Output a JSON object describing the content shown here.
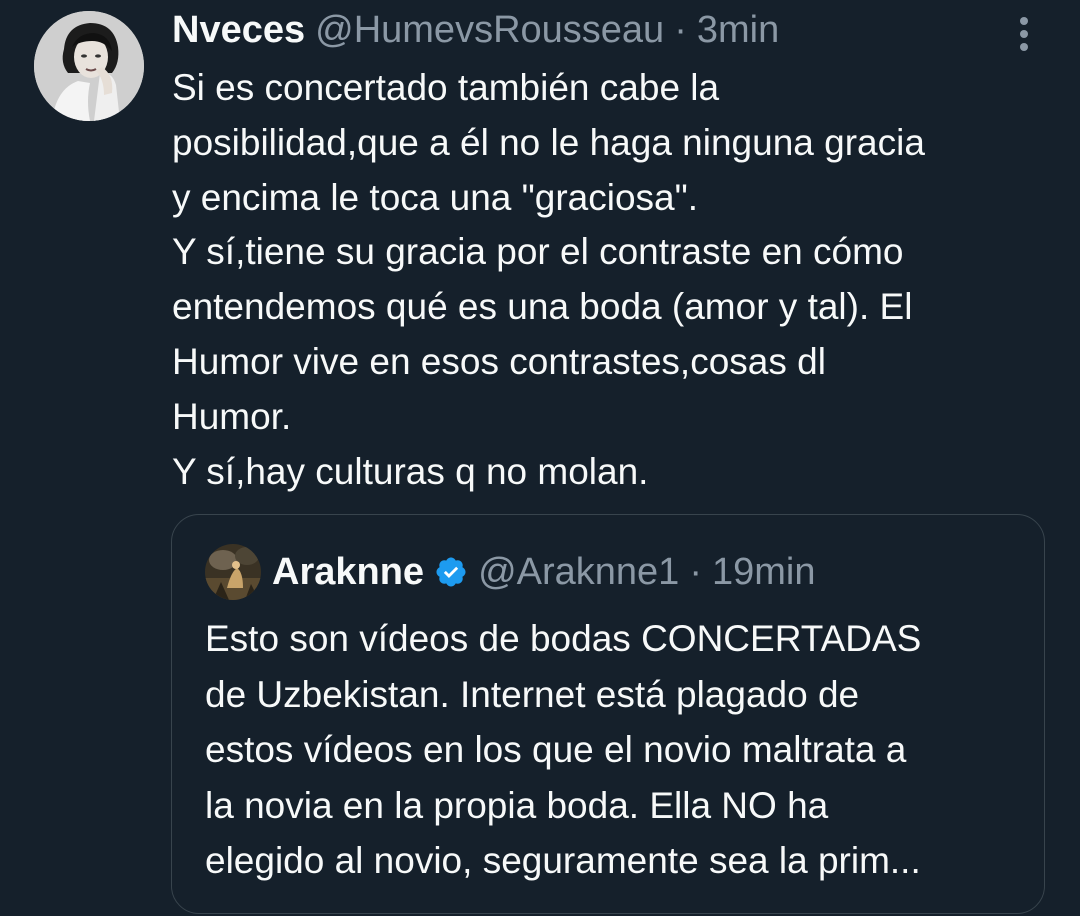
{
  "tweet": {
    "name": "Nveces",
    "handle": "@HumevsRousseau",
    "separator": "·",
    "time": "3min",
    "lines": [
      "Si es concertado también cabe la",
      "posibilidad,que a él no le haga ninguna gracia",
      "y encima le toca una \"graciosa\".",
      "Y sí,tiene su gracia por el contraste en cómo",
      "entendemos qué es una boda (amor y tal). El",
      "Humor vive en esos contrastes,cosas dl",
      "Humor.",
      "Y sí,hay culturas q no molan."
    ]
  },
  "quote": {
    "name": "Araknne",
    "handle": "@Araknne1",
    "separator": "·",
    "time": "19min",
    "verified_icon": "verified-badge-icon",
    "lines": [
      "Esto son vídeos de bodas CONCERTADAS",
      "de Uzbekistan. Internet está plagado de",
      "estos vídeos en los que el novio maltrata a",
      "la novia en la propia boda. Ella NO ha",
      "elegido al novio, seguramente sea la prim..."
    ]
  },
  "icons": {
    "more": "more-options-icon"
  },
  "colors": {
    "background": "#15202b",
    "text": "#f7f9f9",
    "secondary": "#8b98a5",
    "border": "#38444d",
    "verified": "#1d9bf0"
  }
}
